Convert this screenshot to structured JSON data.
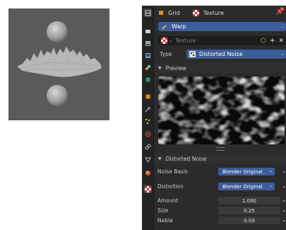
{
  "header": {
    "grid_label": "Grid",
    "texture_label": "Texture"
  },
  "modifier": {
    "name": "Warp"
  },
  "texture_field": {
    "placeholder": "Texture"
  },
  "type_row": {
    "label": "Type",
    "value": "Distorted Noise"
  },
  "preview": {
    "title": "Preview"
  },
  "noise_panel": {
    "title": "Distorted Noise",
    "noise_basis_label": "Noise Basis",
    "noise_basis_value": "Blender Original",
    "distortion_label": "Distortion",
    "distortion_value": "Blender Original",
    "amount_label": "Amount",
    "amount_value": "1.000",
    "size_label": "Size",
    "size_value": "0.25",
    "nabla_label": "Nabla",
    "nabla_value": "0.03"
  },
  "colors": {
    "accent": "#3c5d9a",
    "panel_bg": "#2b2b2b",
    "sidebar_bg": "#232323"
  },
  "sidebar_icons": [
    "tool-icon",
    "render-icon",
    "output-icon",
    "view-layer-icon",
    "scene-icon",
    "world-icon",
    "object-icon",
    "modifier-icon",
    "particles-icon",
    "physics-icon",
    "constraints-icon",
    "data-icon",
    "material-icon",
    "texture-icon"
  ]
}
